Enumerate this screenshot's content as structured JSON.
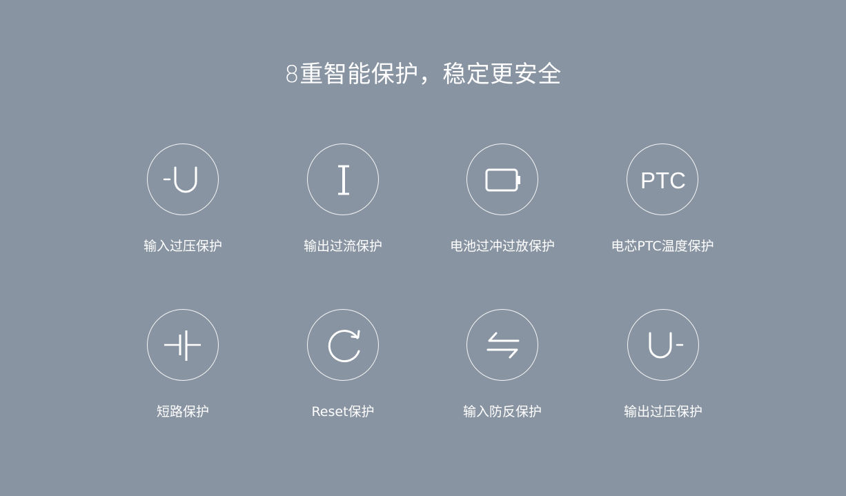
{
  "title": "8重智能保护，稳定更安全",
  "features": [
    {
      "label": "输入过压保护",
      "icon": "input-overvoltage-icon"
    },
    {
      "label": "输出过流保护",
      "icon": "output-overcurrent-icon"
    },
    {
      "label": "电池过冲过放保护",
      "icon": "battery-icon"
    },
    {
      "label": "电芯PTC温度保护",
      "icon": "ptc-icon",
      "icon_text": "PTC"
    },
    {
      "label": "短路保护",
      "icon": "short-circuit-icon"
    },
    {
      "label": "Reset保护",
      "icon": "reset-icon"
    },
    {
      "label": "输入防反保护",
      "icon": "reverse-arrows-icon"
    },
    {
      "label": "输出过压保护",
      "icon": "output-overvoltage-icon"
    }
  ],
  "colors": {
    "background": "#8994a2",
    "foreground": "#ffffff"
  }
}
